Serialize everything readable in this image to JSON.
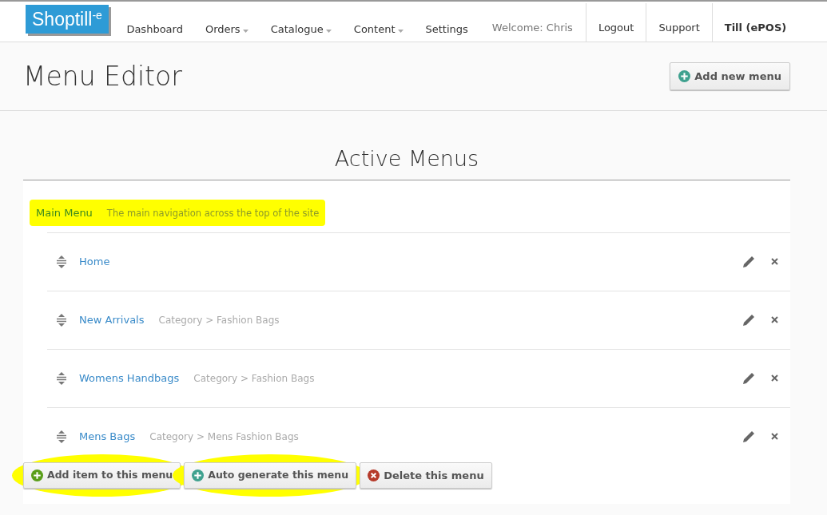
{
  "brand": {
    "logo_text": "Shoptill",
    "logo_suffix": "-e"
  },
  "nav": [
    {
      "label": "Dashboard",
      "dropdown": false
    },
    {
      "label": "Orders",
      "dropdown": true
    },
    {
      "label": "Catalogue",
      "dropdown": true
    },
    {
      "label": "Content",
      "dropdown": true
    },
    {
      "label": "Settings",
      "dropdown": false
    }
  ],
  "welcome": "Welcome: Chris",
  "nav_right": [
    {
      "label": "Logout",
      "bold": false
    },
    {
      "label": "Support",
      "bold": false
    },
    {
      "label": "Till (ePOS)",
      "bold": true
    }
  ],
  "page_title": "Menu Editor",
  "add_menu_button": "Add new menu",
  "section_title": "Active Menus",
  "menu": {
    "name": "Main Menu",
    "description": "The main navigation across the top of the site",
    "highlighted": true
  },
  "items": [
    {
      "label": "Home"
    },
    {
      "label": "New Arrivals",
      "target": "Category > Fashion Bags"
    },
    {
      "label": "Womens Handbags",
      "target": "Category > Fashion Bags"
    },
    {
      "label": "Mens Bags",
      "target": "Category > Mens Fashion Bags"
    }
  ],
  "actions": [
    {
      "label": "Add item to this menu",
      "kind": "add",
      "highlighted": true
    },
    {
      "label": "Auto generate this menu",
      "kind": "auto",
      "highlighted": true
    },
    {
      "label": "Delete this menu",
      "kind": "delete",
      "highlighted": false
    }
  ]
}
